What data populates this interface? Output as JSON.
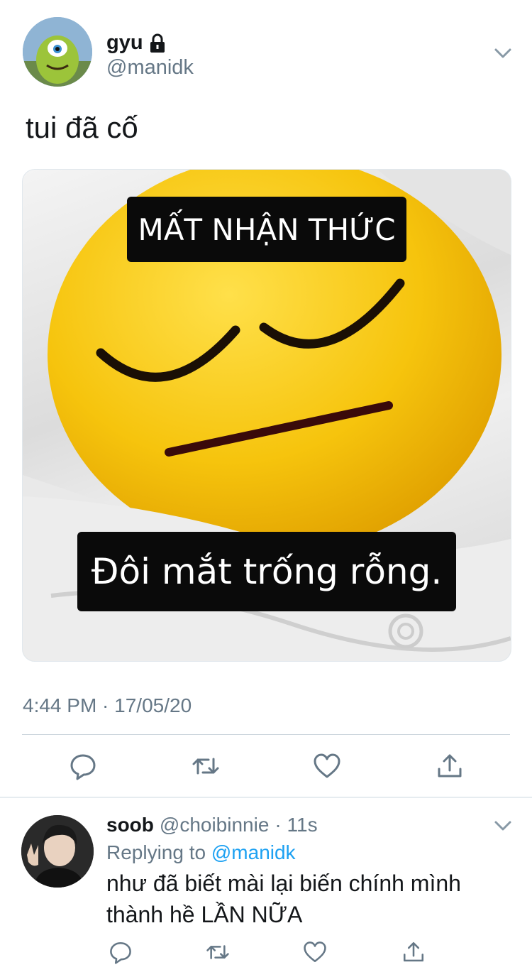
{
  "tweet": {
    "display_name": "gyu",
    "handle": "@manidk",
    "text": "tui đã cố",
    "image": {
      "top_caption": "MẤT NHẬN THỨC",
      "bottom_caption": "Đôi mắt trống rỗng."
    },
    "timestamp": "4:44 PM · 17/05/20"
  },
  "reply": {
    "display_name": "soob",
    "handle": "@choibinnie",
    "age": "· 11s",
    "replying_prefix": "Replying to",
    "replying_to": "@manidk",
    "text": "như đã biết mài lại biến chính mình thành hề LẦN NỮA"
  },
  "colors": {
    "accent": "#1da1f2",
    "secondary_text": "#657786",
    "emoji_yellow": "#f6c40d"
  },
  "icons": [
    "lock-icon",
    "chevron-down-icon",
    "reply-icon",
    "retweet-icon",
    "like-icon",
    "share-icon"
  ]
}
